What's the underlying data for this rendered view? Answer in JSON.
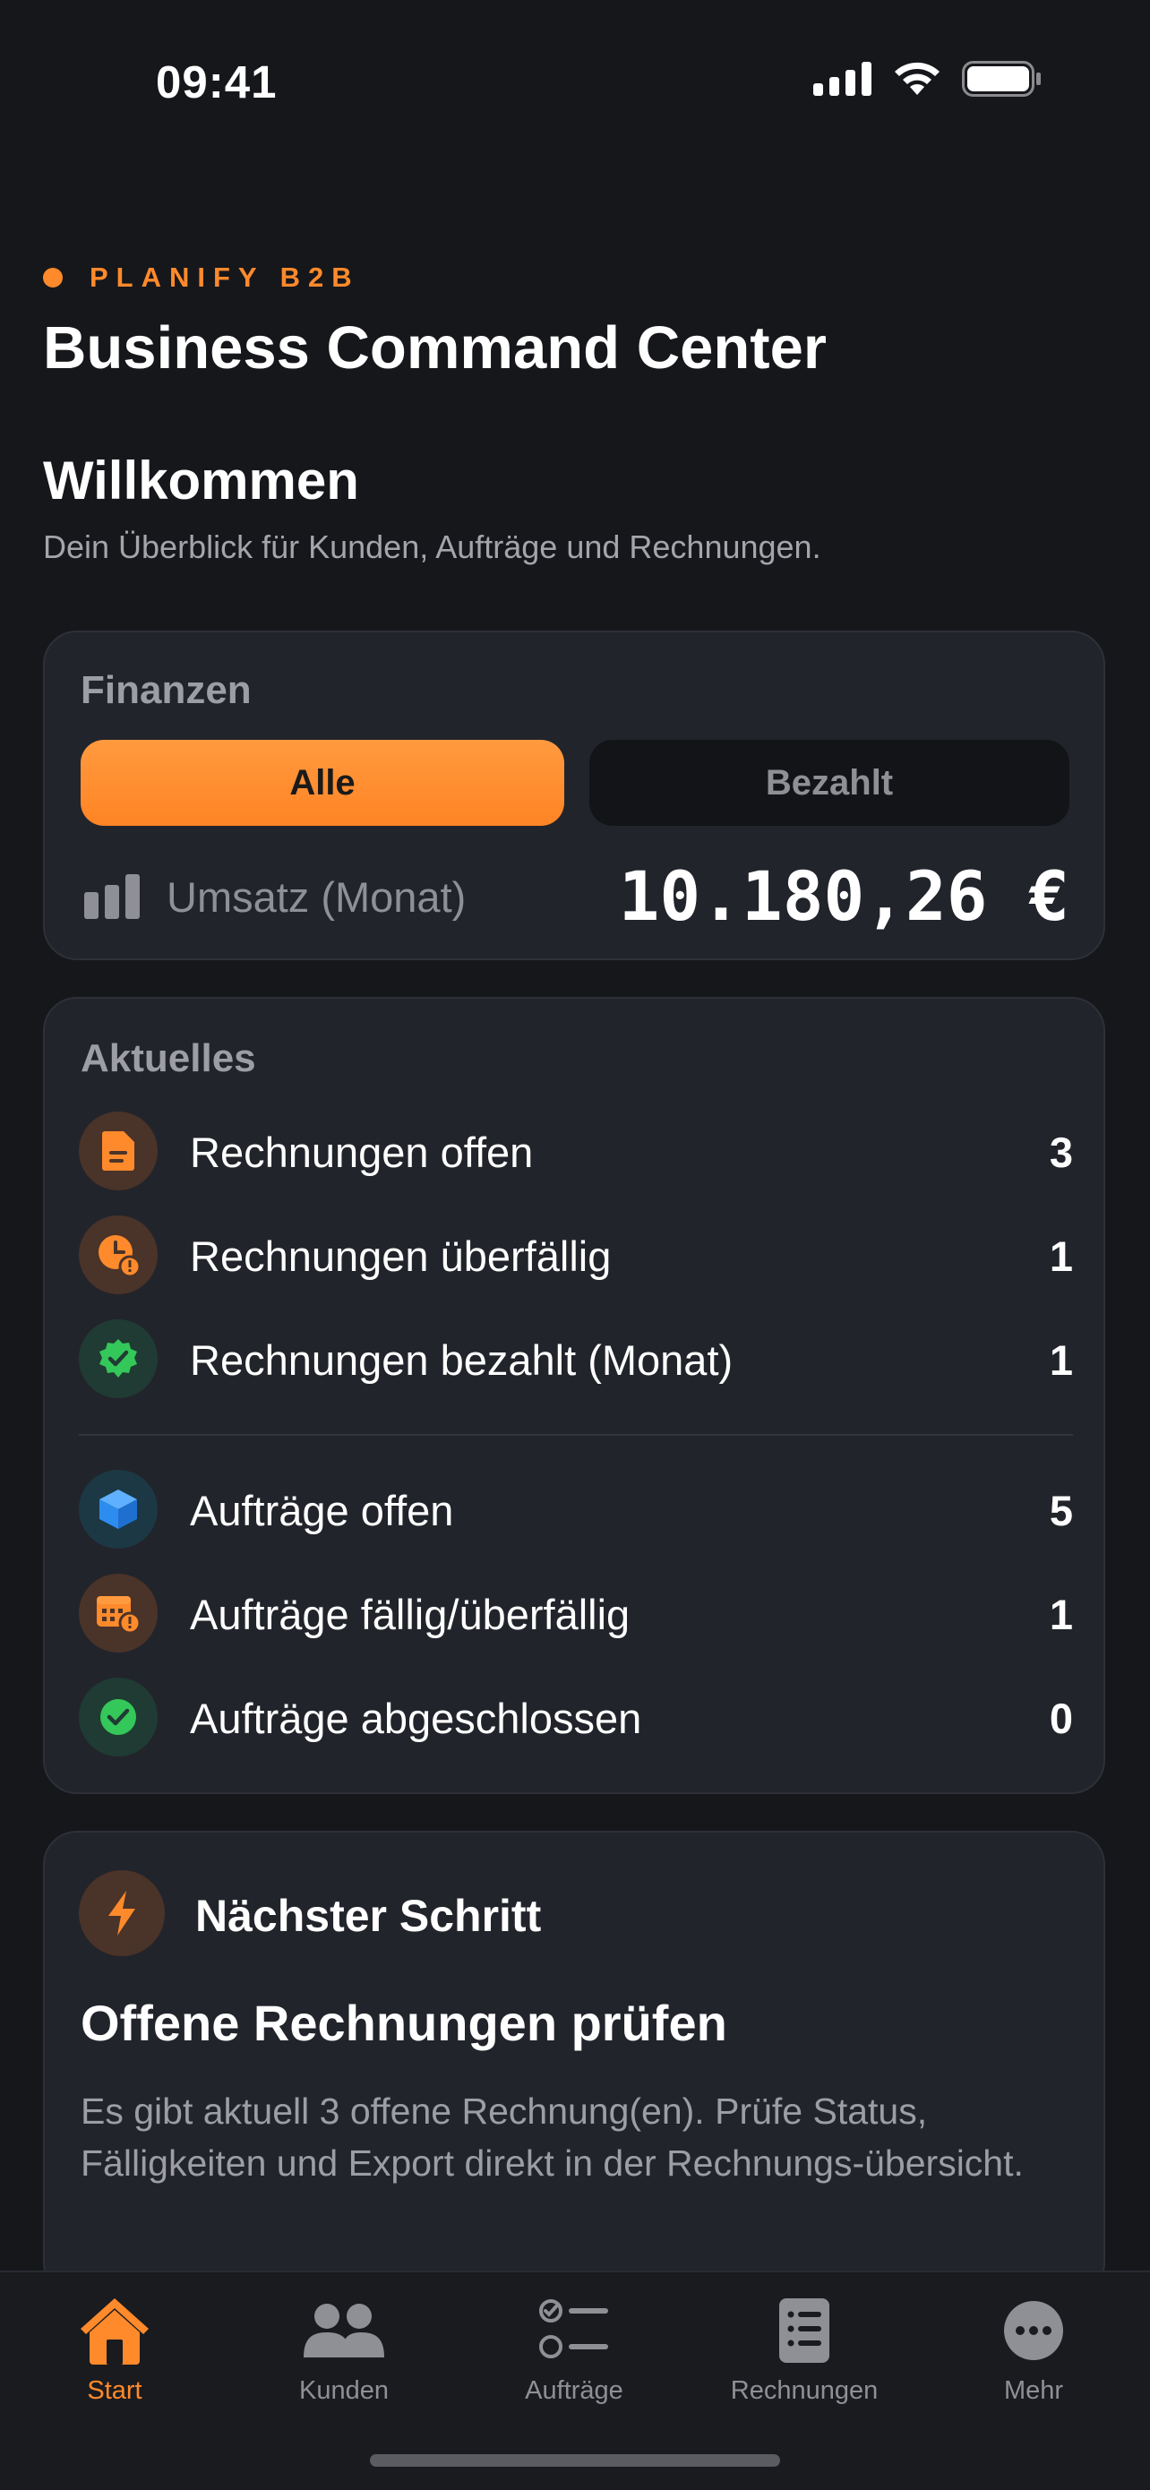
{
  "status_bar": {
    "time": "09:41"
  },
  "header": {
    "brand": "PLANIFY B2B",
    "title": "Business Command Center",
    "welcome": "Willkommen",
    "subtitle": "Dein Überblick für Kunden, Aufträge und Rechnungen."
  },
  "finance": {
    "title": "Finanzen",
    "segments": [
      "Alle",
      "Bezahlt"
    ],
    "selected_segment": "Alle",
    "revenue_label": "Umsatz (Monat)",
    "revenue_value": "10.180,26 €"
  },
  "news": {
    "title": "Aktuelles",
    "invoice_rows": [
      {
        "label": "Rechnungen offen",
        "count": "3",
        "icon": "document-icon"
      },
      {
        "label": "Rechnungen überfällig",
        "count": "1",
        "icon": "clock-alert-icon"
      },
      {
        "label": "Rechnungen bezahlt (Monat)",
        "count": "1",
        "icon": "checkmark-seal-icon"
      }
    ],
    "order_rows": [
      {
        "label": "Aufträge offen",
        "count": "5",
        "icon": "box-icon"
      },
      {
        "label": "Aufträge fällig/überfällig",
        "count": "1",
        "icon": "calendar-alert-icon"
      },
      {
        "label": "Aufträge abgeschlossen",
        "count": "0",
        "icon": "check-circle-icon"
      }
    ]
  },
  "next_step": {
    "label": "Nächster Schritt",
    "headline": "Offene Rechnungen prüfen",
    "body": "Es gibt aktuell 3 offene Rechnung(en). Prüfe Status, Fälligkeiten und Export direkt in der Rechnungs-übersicht."
  },
  "tabbar": {
    "items": [
      {
        "label": "Start",
        "icon": "home-icon"
      },
      {
        "label": "Kunden",
        "icon": "people-icon"
      },
      {
        "label": "Aufträge",
        "icon": "checklist-icon"
      },
      {
        "label": "Rechnungen",
        "icon": "list-document-icon"
      },
      {
        "label": "Mehr",
        "icon": "more-icon"
      }
    ],
    "active": "Start"
  },
  "colors": {
    "accent": "#ff8a2b",
    "background": "#16171b",
    "card": "#22242b",
    "success": "#34c759",
    "info": "#2d8cf0"
  }
}
